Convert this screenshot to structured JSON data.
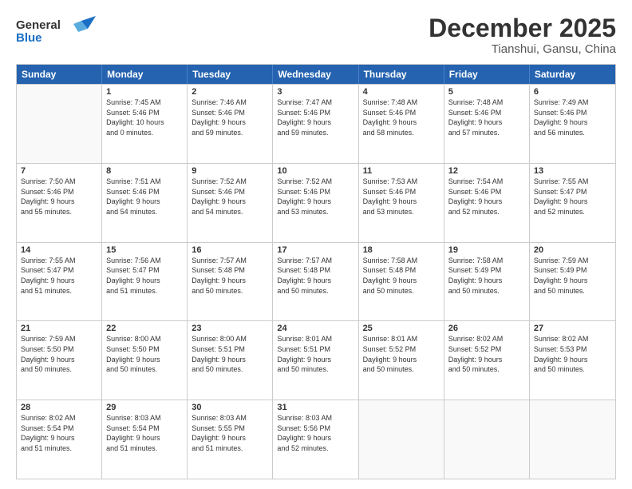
{
  "header": {
    "logo_general": "General",
    "logo_blue": "Blue",
    "month": "December 2025",
    "location": "Tianshui, Gansu, China"
  },
  "weekdays": [
    "Sunday",
    "Monday",
    "Tuesday",
    "Wednesday",
    "Thursday",
    "Friday",
    "Saturday"
  ],
  "rows": [
    [
      {
        "day": "",
        "info": ""
      },
      {
        "day": "1",
        "info": "Sunrise: 7:45 AM\nSunset: 5:46 PM\nDaylight: 10 hours\nand 0 minutes."
      },
      {
        "day": "2",
        "info": "Sunrise: 7:46 AM\nSunset: 5:46 PM\nDaylight: 9 hours\nand 59 minutes."
      },
      {
        "day": "3",
        "info": "Sunrise: 7:47 AM\nSunset: 5:46 PM\nDaylight: 9 hours\nand 59 minutes."
      },
      {
        "day": "4",
        "info": "Sunrise: 7:48 AM\nSunset: 5:46 PM\nDaylight: 9 hours\nand 58 minutes."
      },
      {
        "day": "5",
        "info": "Sunrise: 7:48 AM\nSunset: 5:46 PM\nDaylight: 9 hours\nand 57 minutes."
      },
      {
        "day": "6",
        "info": "Sunrise: 7:49 AM\nSunset: 5:46 PM\nDaylight: 9 hours\nand 56 minutes."
      }
    ],
    [
      {
        "day": "7",
        "info": "Sunrise: 7:50 AM\nSunset: 5:46 PM\nDaylight: 9 hours\nand 55 minutes."
      },
      {
        "day": "8",
        "info": "Sunrise: 7:51 AM\nSunset: 5:46 PM\nDaylight: 9 hours\nand 54 minutes."
      },
      {
        "day": "9",
        "info": "Sunrise: 7:52 AM\nSunset: 5:46 PM\nDaylight: 9 hours\nand 54 minutes."
      },
      {
        "day": "10",
        "info": "Sunrise: 7:52 AM\nSunset: 5:46 PM\nDaylight: 9 hours\nand 53 minutes."
      },
      {
        "day": "11",
        "info": "Sunrise: 7:53 AM\nSunset: 5:46 PM\nDaylight: 9 hours\nand 53 minutes."
      },
      {
        "day": "12",
        "info": "Sunrise: 7:54 AM\nSunset: 5:46 PM\nDaylight: 9 hours\nand 52 minutes."
      },
      {
        "day": "13",
        "info": "Sunrise: 7:55 AM\nSunset: 5:47 PM\nDaylight: 9 hours\nand 52 minutes."
      }
    ],
    [
      {
        "day": "14",
        "info": "Sunrise: 7:55 AM\nSunset: 5:47 PM\nDaylight: 9 hours\nand 51 minutes."
      },
      {
        "day": "15",
        "info": "Sunrise: 7:56 AM\nSunset: 5:47 PM\nDaylight: 9 hours\nand 51 minutes."
      },
      {
        "day": "16",
        "info": "Sunrise: 7:57 AM\nSunset: 5:48 PM\nDaylight: 9 hours\nand 50 minutes."
      },
      {
        "day": "17",
        "info": "Sunrise: 7:57 AM\nSunset: 5:48 PM\nDaylight: 9 hours\nand 50 minutes."
      },
      {
        "day": "18",
        "info": "Sunrise: 7:58 AM\nSunset: 5:48 PM\nDaylight: 9 hours\nand 50 minutes."
      },
      {
        "day": "19",
        "info": "Sunrise: 7:58 AM\nSunset: 5:49 PM\nDaylight: 9 hours\nand 50 minutes."
      },
      {
        "day": "20",
        "info": "Sunrise: 7:59 AM\nSunset: 5:49 PM\nDaylight: 9 hours\nand 50 minutes."
      }
    ],
    [
      {
        "day": "21",
        "info": "Sunrise: 7:59 AM\nSunset: 5:50 PM\nDaylight: 9 hours\nand 50 minutes."
      },
      {
        "day": "22",
        "info": "Sunrise: 8:00 AM\nSunset: 5:50 PM\nDaylight: 9 hours\nand 50 minutes."
      },
      {
        "day": "23",
        "info": "Sunrise: 8:00 AM\nSunset: 5:51 PM\nDaylight: 9 hours\nand 50 minutes."
      },
      {
        "day": "24",
        "info": "Sunrise: 8:01 AM\nSunset: 5:51 PM\nDaylight: 9 hours\nand 50 minutes."
      },
      {
        "day": "25",
        "info": "Sunrise: 8:01 AM\nSunset: 5:52 PM\nDaylight: 9 hours\nand 50 minutes."
      },
      {
        "day": "26",
        "info": "Sunrise: 8:02 AM\nSunset: 5:52 PM\nDaylight: 9 hours\nand 50 minutes."
      },
      {
        "day": "27",
        "info": "Sunrise: 8:02 AM\nSunset: 5:53 PM\nDaylight: 9 hours\nand 50 minutes."
      }
    ],
    [
      {
        "day": "28",
        "info": "Sunrise: 8:02 AM\nSunset: 5:54 PM\nDaylight: 9 hours\nand 51 minutes."
      },
      {
        "day": "29",
        "info": "Sunrise: 8:03 AM\nSunset: 5:54 PM\nDaylight: 9 hours\nand 51 minutes."
      },
      {
        "day": "30",
        "info": "Sunrise: 8:03 AM\nSunset: 5:55 PM\nDaylight: 9 hours\nand 51 minutes."
      },
      {
        "day": "31",
        "info": "Sunrise: 8:03 AM\nSunset: 5:56 PM\nDaylight: 9 hours\nand 52 minutes."
      },
      {
        "day": "",
        "info": ""
      },
      {
        "day": "",
        "info": ""
      },
      {
        "day": "",
        "info": ""
      }
    ]
  ]
}
